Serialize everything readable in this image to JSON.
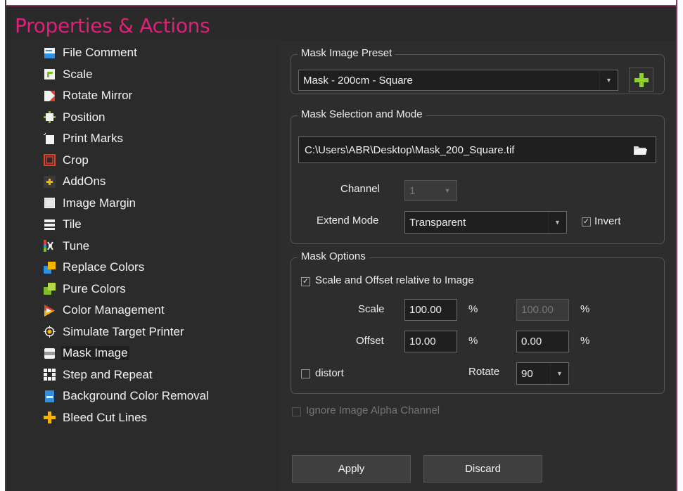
{
  "window": {
    "title": "Properties & Actions",
    "accent_color": "#e0207a"
  },
  "sidebar": {
    "items": [
      {
        "label": "File Comment",
        "icon": "file-comment-icon"
      },
      {
        "label": "Scale",
        "icon": "scale-icon"
      },
      {
        "label": "Rotate Mirror",
        "icon": "rotate-mirror-icon"
      },
      {
        "label": "Position",
        "icon": "position-icon"
      },
      {
        "label": "Print Marks",
        "icon": "print-marks-icon"
      },
      {
        "label": "Crop",
        "icon": "crop-icon"
      },
      {
        "label": "AddOns",
        "icon": "addons-icon"
      },
      {
        "label": "Image Margin",
        "icon": "image-margin-icon"
      },
      {
        "label": "Tile",
        "icon": "tile-icon"
      },
      {
        "label": "Tune",
        "icon": "tune-icon"
      },
      {
        "label": "Replace Colors",
        "icon": "replace-colors-icon"
      },
      {
        "label": "Pure Colors",
        "icon": "pure-colors-icon"
      },
      {
        "label": "Color Management",
        "icon": "color-management-icon"
      },
      {
        "label": "Simulate Target Printer",
        "icon": "simulate-target-printer-icon"
      },
      {
        "label": "Mask Image",
        "icon": "mask-image-icon",
        "selected": true
      },
      {
        "label": "Step and Repeat",
        "icon": "step-repeat-icon"
      },
      {
        "label": "Background Color Removal",
        "icon": "background-color-removal-icon"
      },
      {
        "label": "Bleed Cut Lines",
        "icon": "bleed-cut-lines-icon"
      }
    ]
  },
  "preset": {
    "group_title": "Mask Image Preset",
    "value": "Mask - 200cm - Square",
    "add_icon": "plus-icon"
  },
  "selection": {
    "group_title": "Mask Selection and Mode",
    "file_path": "C:\\Users\\ABR\\Desktop\\Mask_200_Square.tif",
    "folder_icon": "folder-icon",
    "channel_label": "Channel",
    "channel_value": "1",
    "extend_label": "Extend Mode",
    "extend_value": "Transparent",
    "invert_label": "Invert",
    "invert_checked": true
  },
  "options": {
    "group_title": "Mask Options",
    "relative_label": "Scale and Offset relative to Image",
    "relative_checked": true,
    "scale_label": "Scale",
    "scale_x": "100.00",
    "scale_y": "100.00",
    "offset_label": "Offset",
    "offset_x": "10.00",
    "offset_y": "0.00",
    "unit_x1": "%",
    "unit_x2": "%",
    "unit_y1": "%",
    "unit_y2": "%",
    "distort_label": "distort",
    "distort_checked": false,
    "rotate_label": "Rotate",
    "rotate_value": "90"
  },
  "ignore_alpha": {
    "label": "Ignore Image Alpha Channel",
    "checked": false
  },
  "actions": {
    "apply_label": "Apply",
    "discard_label": "Discard"
  }
}
